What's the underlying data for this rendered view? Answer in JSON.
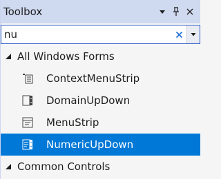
{
  "panel": {
    "title": "Toolbox",
    "pin_glyph": "⬇",
    "close_glyph": "✕"
  },
  "search": {
    "value": "nu",
    "clear_glyph": "✕"
  },
  "groups": [
    {
      "label": "All Windows Forms",
      "expanded": true,
      "items": [
        {
          "label": "ContextMenuStrip",
          "icon": "context-menu-strip-icon"
        },
        {
          "label": "DomainUpDown",
          "icon": "domain-up-down-icon"
        },
        {
          "label": "MenuStrip",
          "icon": "menu-strip-icon"
        },
        {
          "label": "NumericUpDown",
          "icon": "numeric-up-down-icon",
          "selected": true
        }
      ]
    },
    {
      "label": "Common Controls",
      "expanded": true
    }
  ],
  "colors": {
    "selection": "#0078d7",
    "titlebar": "#cfd9ef",
    "search_border": "#2b59c3"
  }
}
